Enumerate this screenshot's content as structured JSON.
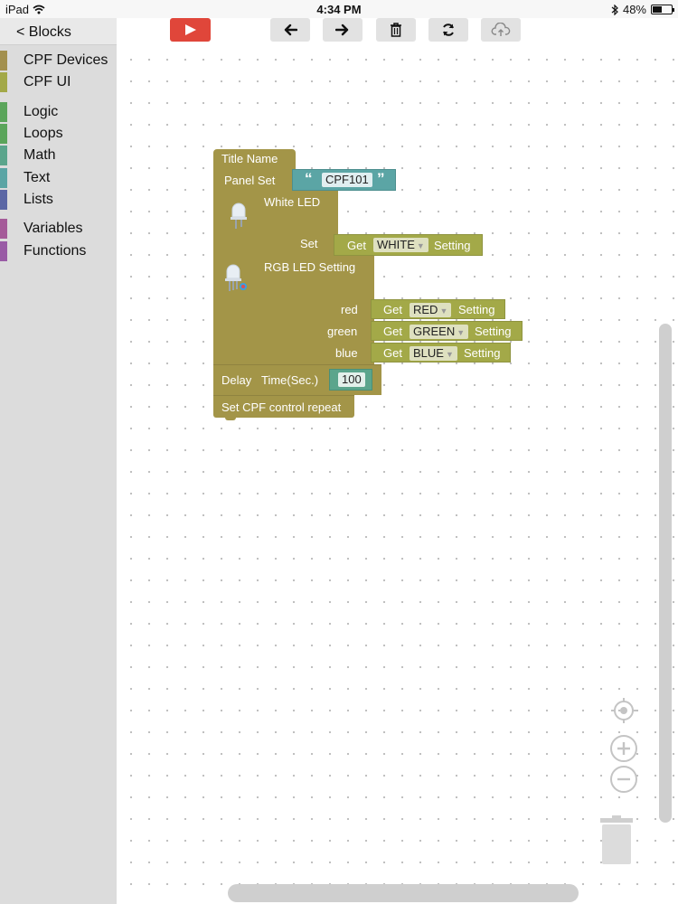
{
  "status_bar": {
    "device": "iPad",
    "time": "4:34 PM",
    "battery": "48%",
    "battery_fraction": 0.48
  },
  "sidebar": {
    "back_label": "< Blocks",
    "categories": [
      {
        "label": "CPF Devices",
        "color": "#a3904e"
      },
      {
        "label": "CPF UI",
        "color": "#a3a948"
      },
      {
        "label": "Logic",
        "color": "#5ba55b"
      },
      {
        "label": "Loops",
        "color": "#5ba55b"
      },
      {
        "label": "Math",
        "color": "#5ba58c"
      },
      {
        "label": "Text",
        "color": "#5ba5a5"
      },
      {
        "label": "Lists",
        "color": "#5b67a5"
      },
      {
        "label": "Variables",
        "color": "#a55b99"
      },
      {
        "label": "Functions",
        "color": "#995ba5"
      }
    ]
  },
  "toolbar": {
    "buttons": [
      "run",
      "undo",
      "redo",
      "delete",
      "refresh",
      "cloud-upload"
    ],
    "run_color": "#e0463a"
  },
  "program": {
    "title_name": "Title Name",
    "panel_set": "Panel Set",
    "panel_text": "CPF101",
    "white_led": {
      "label": "White LED",
      "set_label": "Set",
      "get": "Get",
      "value": "WHITE",
      "setting": "Setting"
    },
    "rgb_led": {
      "label": "RGB LED Setting",
      "rows": [
        {
          "label": "red",
          "get": "Get",
          "value": "RED",
          "setting": "Setting"
        },
        {
          "label": "green",
          "get": "Get",
          "value": "GREEN",
          "setting": "Setting"
        },
        {
          "label": "blue",
          "get": "Get",
          "value": "BLUE",
          "setting": "Setting"
        }
      ]
    },
    "delay": {
      "label": "Delay",
      "time_label": "Time(Sec.)",
      "value": "100"
    },
    "repeat_label": "Set CPF control repeat"
  },
  "workspace_controls": [
    "recenter-icon",
    "zoom-in-icon",
    "zoom-out-icon",
    "trash-icon"
  ],
  "colors": {
    "block": "#a39548",
    "get_block": "#a3a948",
    "text_block": "#5ba5a5",
    "number_block": "#5ba58c"
  }
}
